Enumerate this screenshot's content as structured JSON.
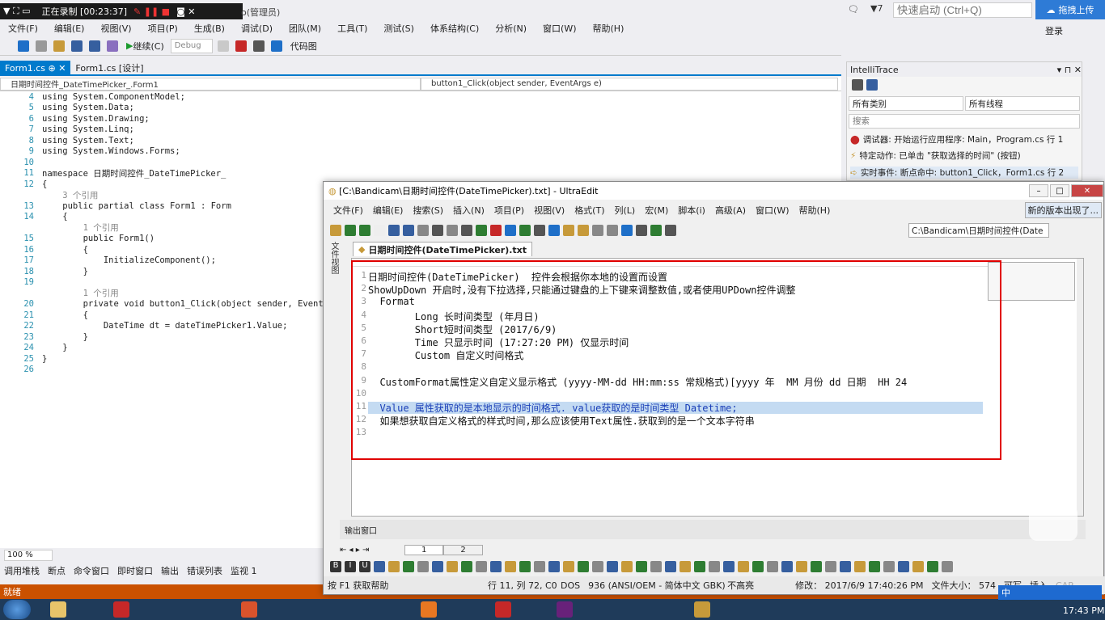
{
  "recorder": {
    "status": "正在录制 [00:23:37]"
  },
  "vs": {
    "title_fragment": "o(管理员)",
    "notifications": "7",
    "quick_launch_placeholder": "快速启动 (Ctrl+Q)",
    "upload_label": "拖拽上传",
    "login_label": "登录",
    "menu": [
      "文件(F)",
      "编辑(E)",
      "视图(V)",
      "项目(P)",
      "生成(B)",
      "调试(D)",
      "团队(M)",
      "工具(T)",
      "测试(S)",
      "体系结构(C)",
      "分析(N)",
      "窗口(W)",
      "帮助(H)"
    ],
    "toolbar": {
      "continue": "继续(C)",
      "config": "Debug",
      "code_map": "代码图"
    },
    "tabs": [
      "Form1.cs",
      "Form1.cs [设计]"
    ],
    "nav": {
      "left": "日期时间控件_DateTimePicker_.Form1",
      "right": "button1_Click(object sender, EventArgs e)"
    },
    "code_lines": [
      {
        "n": "4",
        "t": "using System.ComponentModel;",
        "cls": ""
      },
      {
        "n": "5",
        "t": "using System.Data;",
        "cls": ""
      },
      {
        "n": "6",
        "t": "using System.Drawing;",
        "cls": ""
      },
      {
        "n": "7",
        "t": "using System.Linq;",
        "cls": ""
      },
      {
        "n": "8",
        "t": "using System.Text;",
        "cls": ""
      },
      {
        "n": "9",
        "t": "using System.Windows.Forms;",
        "cls": ""
      },
      {
        "n": "10",
        "t": "",
        "cls": ""
      },
      {
        "n": "11",
        "t": "namespace 日期时间控件_DateTimePicker_",
        "cls": ""
      },
      {
        "n": "12",
        "t": "{",
        "cls": ""
      },
      {
        "n": "",
        "t": "    3 个引用",
        "cls": "cm"
      },
      {
        "n": "13",
        "t": "    public partial class Form1 : Form",
        "cls": ""
      },
      {
        "n": "14",
        "t": "    {",
        "cls": ""
      },
      {
        "n": "",
        "t": "        1 个引用",
        "cls": "cm"
      },
      {
        "n": "15",
        "t": "        public Form1()",
        "cls": ""
      },
      {
        "n": "16",
        "t": "        {",
        "cls": ""
      },
      {
        "n": "17",
        "t": "            InitializeComponent();",
        "cls": ""
      },
      {
        "n": "18",
        "t": "        }",
        "cls": ""
      },
      {
        "n": "19",
        "t": "",
        "cls": ""
      },
      {
        "n": "",
        "t": "        1 个引用",
        "cls": "cm"
      },
      {
        "n": "20",
        "t": "        private void button1_Click(object sender, Event",
        "cls": ""
      },
      {
        "n": "21",
        "t": "        {",
        "cls": ""
      },
      {
        "n": "22",
        "t": "            DateTime dt = dateTimePicker1.Value;",
        "cls": ""
      },
      {
        "n": "23",
        "t": "        }",
        "cls": ""
      },
      {
        "n": "24",
        "t": "    }",
        "cls": ""
      },
      {
        "n": "25",
        "t": "}",
        "cls": ""
      },
      {
        "n": "26",
        "t": "",
        "cls": ""
      }
    ],
    "zoom": "100 %",
    "bottom_tabs": [
      "调用堆栈",
      "断点",
      "命令窗口",
      "即时窗口",
      "输出",
      "错误列表",
      "监视 1"
    ],
    "status": "就绪"
  },
  "intellitrace": {
    "title": "IntelliTrace",
    "category": "所有类别",
    "thread": "所有线程",
    "search_placeholder": "搜索",
    "events": [
      "调试器: 开始运行应用程序: Main，Program.cs 行 1",
      "特定动作: 已单击 \"获取选择的时间\" (按钮)",
      "实时事件: 断点命中: button1_Click，Form1.cs 行 2"
    ]
  },
  "ultraedit": {
    "title": "[C:\\Bandicam\\日期时间控件(DateTimePicker).txt] - UltraEdit",
    "menu": [
      "文件(F)",
      "编辑(E)",
      "搜索(S)",
      "插入(N)",
      "项目(P)",
      "视图(V)",
      "格式(T)",
      "列(L)",
      "宏(M)",
      "脚本(i)",
      "高级(A)",
      "窗口(W)",
      "帮助(H)"
    ],
    "new_version": "新的版本出现了...",
    "path_combo": "C:\\Bandicam\\日期时间控件(Date",
    "side_tab": "文件视图",
    "doc_tab": "日期时间控件(DateTimePicker).txt",
    "lines": [
      {
        "n": "1",
        "t": "日期时间控件(DateTimePicker)  控件会根据你本地的设置而设置"
      },
      {
        "n": "2",
        "t": "ShowUpDown 开启时,没有下拉选择,只能通过键盘的上下键来调整数值,或者使用UPDown控件调整"
      },
      {
        "n": "3",
        "t": "  Format"
      },
      {
        "n": "4",
        "t": "        Long 长时间类型 (年月日)"
      },
      {
        "n": "5",
        "t": "        Short短时间类型 (2017/6/9)"
      },
      {
        "n": "6",
        "t": "        Time 只显示时间 (17:27:20 PM) 仅显示时间"
      },
      {
        "n": "7",
        "t": "        Custom 自定义时间格式"
      },
      {
        "n": "8",
        "t": ""
      },
      {
        "n": "9",
        "t": "  CustomFormat属性定义自定义显示格式 (yyyy-MM-dd HH:mm:ss 常规格式)[yyyy 年  MM 月份 dd 日期  HH 24"
      },
      {
        "n": "10",
        "t": ""
      },
      {
        "n": "11",
        "t": "  Value 属性获取的是本地显示的时间格式. value获取的是时间类型 Datetime;"
      },
      {
        "n": "12",
        "t": "  如果想获取自定义格式的样式时间,那么应该使用Text属性.获取到的是一个文本字符串"
      },
      {
        "n": "13",
        "t": ""
      }
    ],
    "output_label": "输出窗口",
    "page_tabs": [
      "1",
      "2"
    ],
    "status": {
      "help": "按 F1 获取帮助",
      "position": "行 11, 列 72, C0",
      "format": "DOS",
      "codepage": "936  (ANSI/OEM - 简体中文 GBK)",
      "highlight": "不高亮",
      "modified": "修改： 2017/6/9 17:40:26 PM",
      "filesize": "文件大小： 574",
      "rw": "可写",
      "ins": "插入",
      "cap": "CAP"
    }
  },
  "taskbar": {
    "time": "17:43 PM",
    "ime": "中"
  },
  "colors": {
    "vs_blue": "#007acc",
    "status_orange": "#ca5100",
    "red_box": "#e00000",
    "selection": "#c4dbf2"
  }
}
